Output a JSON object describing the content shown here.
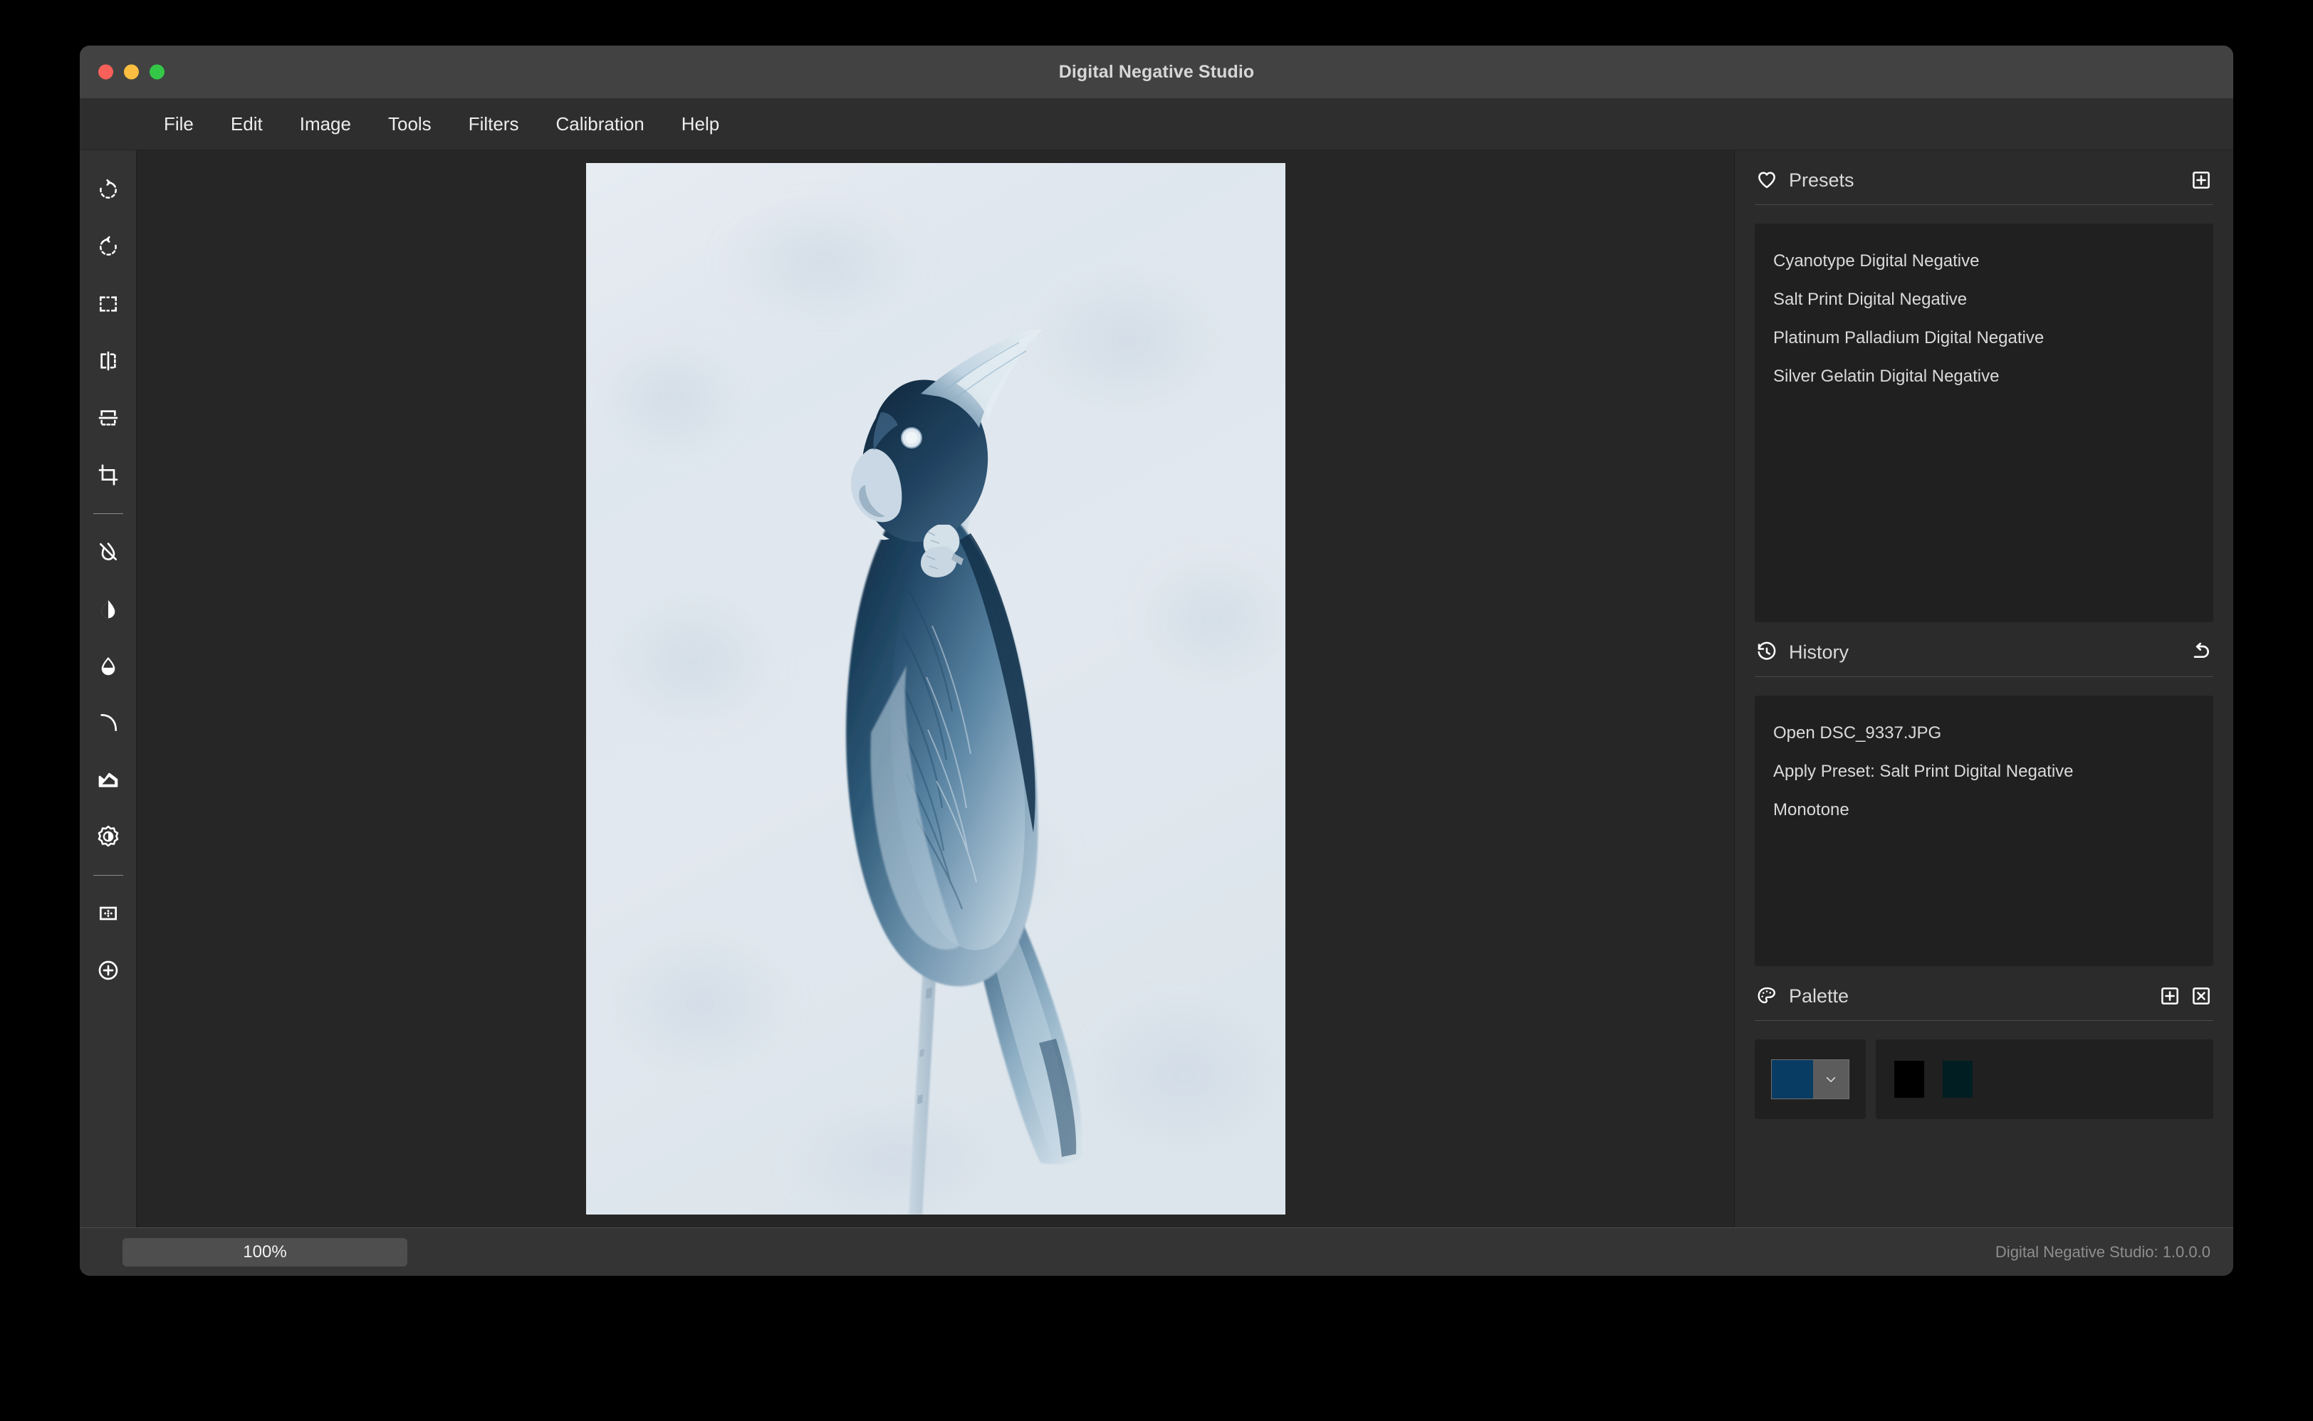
{
  "window": {
    "title": "Digital Negative Studio",
    "traffic_lights": [
      "close-red",
      "minimize-yellow",
      "maximize-green"
    ]
  },
  "menubar": {
    "items": [
      {
        "label": "File"
      },
      {
        "label": "Edit"
      },
      {
        "label": "Image"
      },
      {
        "label": "Tools"
      },
      {
        "label": "Filters"
      },
      {
        "label": "Calibration"
      },
      {
        "label": "Help"
      }
    ]
  },
  "toolbar": {
    "tools": [
      {
        "name": "rotate-right-icon",
        "tip": "Rotate Right"
      },
      {
        "name": "rotate-left-icon",
        "tip": "Rotate Left"
      },
      {
        "name": "select-marquee-icon",
        "tip": "Select"
      },
      {
        "name": "flip-horizontal-icon",
        "tip": "Flip Horizontal"
      },
      {
        "name": "flip-vertical-icon",
        "tip": "Flip Vertical"
      },
      {
        "name": "crop-icon",
        "tip": "Crop"
      },
      {
        "name": "separator",
        "tip": ""
      },
      {
        "name": "desaturate-icon",
        "tip": "Remove Color"
      },
      {
        "name": "contrast-droplet-icon",
        "tip": "Contrast"
      },
      {
        "name": "saturation-droplet-icon",
        "tip": "Saturation"
      },
      {
        "name": "curve-icon",
        "tip": "Curves"
      },
      {
        "name": "levels-icon",
        "tip": "Levels"
      },
      {
        "name": "brightness-icon",
        "tip": "Brightness"
      },
      {
        "name": "separator",
        "tip": ""
      },
      {
        "name": "grain-icon",
        "tip": "Grain"
      },
      {
        "name": "add-layer-icon",
        "tip": "Add"
      }
    ]
  },
  "canvas": {
    "image_name": "DSC_9337.JPG",
    "image_alt": "Cyanotype-toned negative of a cockatoo perched on a thin branch against a pale sky",
    "tone": "#1d4f78"
  },
  "presets": {
    "title": "Presets",
    "icon": "heart-icon",
    "add_label": "+",
    "items": [
      {
        "label": "Cyanotype Digital Negative"
      },
      {
        "label": "Salt Print Digital Negative"
      },
      {
        "label": "Platinum Palladium Digital Negative"
      },
      {
        "label": "Silver Gelatin Digital Negative"
      }
    ]
  },
  "history": {
    "title": "History",
    "icon": "history-clock-icon",
    "undo_label": "undo",
    "items": [
      {
        "label": "Open DSC_9337.JPG"
      },
      {
        "label": "Apply Preset: Salt Print Digital Negative"
      },
      {
        "label": "Monotone"
      }
    ]
  },
  "palette": {
    "title": "Palette",
    "icon": "palette-icon",
    "add_label": "+",
    "remove_label": "x",
    "current_color": "#083C63",
    "swatches": [
      {
        "color": "#000000"
      },
      {
        "color": "#011E22"
      }
    ]
  },
  "statusbar": {
    "zoom": "100%",
    "version": "Digital Negative Studio: 1.0.0.0"
  }
}
